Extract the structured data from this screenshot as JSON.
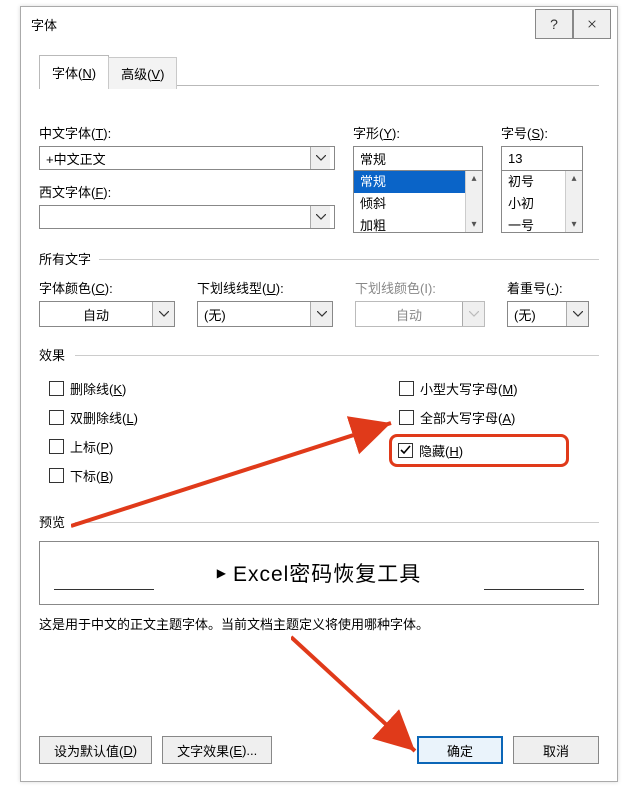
{
  "title": "字体",
  "titlebar": {
    "help": "?",
    "close": "✕"
  },
  "tabs": {
    "font": "字体(N)",
    "advanced": "高级(V)",
    "font_u": "N",
    "advanced_u": "V"
  },
  "chinese_font": {
    "label": "中文字体(T):",
    "u": "T",
    "value": "+中文正文"
  },
  "latin_font": {
    "label": "西文字体(F):",
    "u": "F",
    "value": ""
  },
  "style": {
    "label": "字形(Y):",
    "u": "Y",
    "value": "常规",
    "items": [
      "常规",
      "倾斜",
      "加粗"
    ],
    "selected_index": 0
  },
  "size": {
    "label": "字号(S):",
    "u": "S",
    "value": "13",
    "items": [
      "初号",
      "小初",
      "一号"
    ]
  },
  "all_text": "所有文字",
  "font_color": {
    "label": "字体颜色(C):",
    "u": "C",
    "value": "自动"
  },
  "underline_style": {
    "label": "下划线线型(U):",
    "u": "U",
    "value": "(无)"
  },
  "underline_color": {
    "label": "下划线颜色(I):",
    "u": "I",
    "value": "自动"
  },
  "emphasis": {
    "label": "着重号(·):",
    "value": "(无)"
  },
  "effects_label": "效果",
  "effects": {
    "strike": {
      "label": "删除线(K)",
      "u": "K",
      "checked": false
    },
    "dstrike": {
      "label": "双删除线(L)",
      "u": "L",
      "checked": false
    },
    "super": {
      "label": "上标(P)",
      "u": "P",
      "checked": false
    },
    "sub": {
      "label": "下标(B)",
      "u": "B",
      "checked": false
    },
    "smallcaps": {
      "label": "小型大写字母(M)",
      "u": "M",
      "checked": false
    },
    "allcaps": {
      "label": "全部大写字母(A)",
      "u": "A",
      "checked": false
    },
    "hidden": {
      "label": "隐藏(H)",
      "u": "H",
      "checked": true
    }
  },
  "preview_label": "预览",
  "preview_text": "Excel密码恢复工具",
  "description": "这是用于中文的正文主题字体。当前文档主题定义将使用哪种字体。",
  "buttons": {
    "default": "设为默认值(D)",
    "default_u": "D",
    "texteffects": "文字效果(E)...",
    "texteffects_u": "E",
    "ok": "确定",
    "cancel": "取消"
  }
}
